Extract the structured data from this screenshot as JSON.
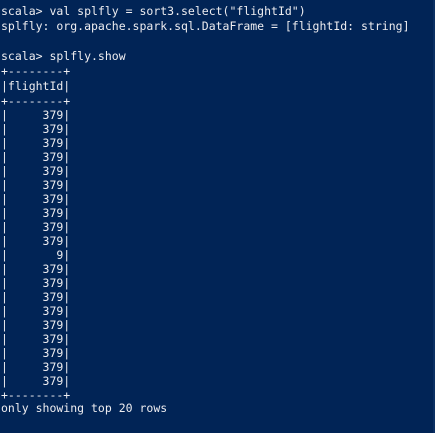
{
  "terminal": {
    "lines": [
      "scala> val splfly = sort3.select(\"flightId\")",
      "splfly: org.apache.spark.sql.DataFrame = [flightId: string]",
      "",
      "scala> splfly.show",
      "+--------+",
      "|flightId|",
      "+--------+",
      "|     379|",
      "|     379|",
      "|     379|",
      "|     379|",
      "|     379|",
      "|     379|",
      "|     379|",
      "|     379|",
      "|     379|",
      "|     379|",
      "|       9|",
      "|     379|",
      "|     379|",
      "|     379|",
      "|     379|",
      "|     379|",
      "|     379|",
      "|     379|",
      "|     379|",
      "|     379|",
      "+--------+",
      "only showing top 20 rows"
    ]
  },
  "colors": {
    "background": "#012456",
    "text": "#eeedf0"
  }
}
